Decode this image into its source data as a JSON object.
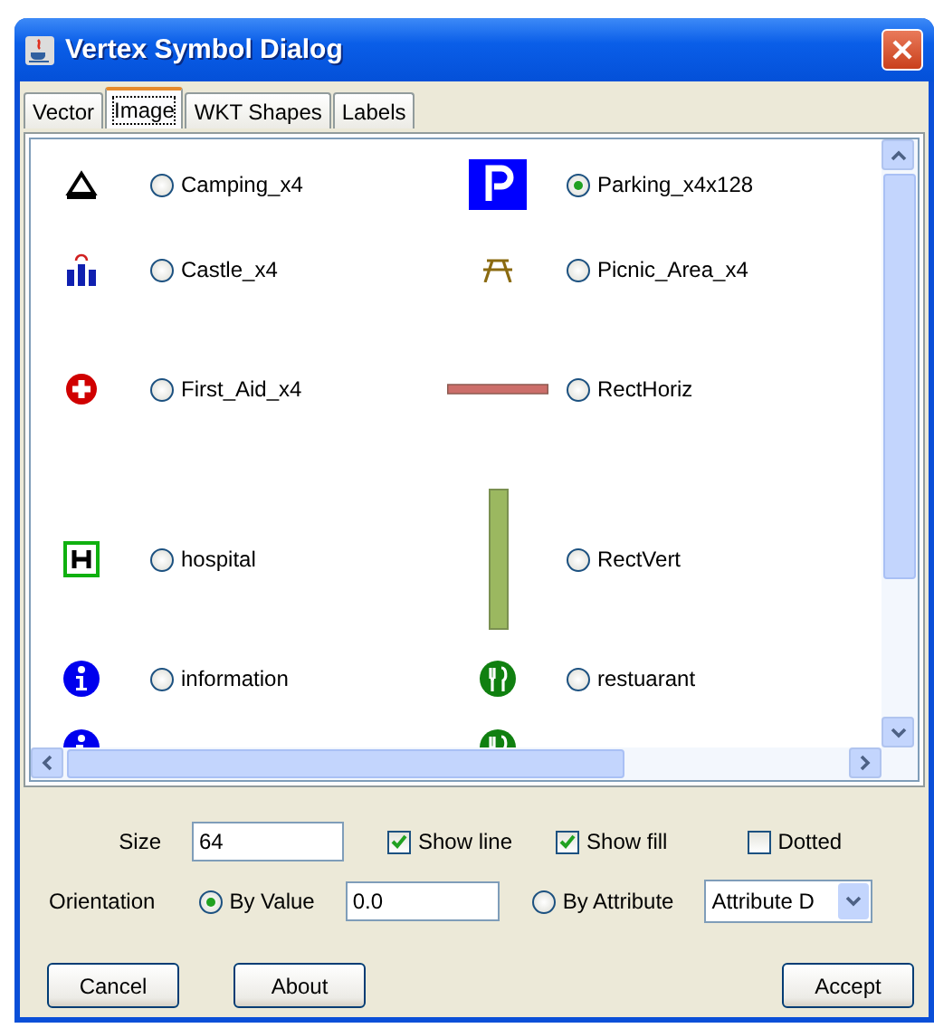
{
  "window": {
    "title": "Vertex Symbol Dialog"
  },
  "tabs": [
    {
      "label": "Vector",
      "selected": false
    },
    {
      "label": "Image",
      "selected": true
    },
    {
      "label": "WKT Shapes",
      "selected": false
    },
    {
      "label": "Labels",
      "selected": false
    }
  ],
  "symbols": [
    {
      "kind": "tent",
      "label": "Camping_x4",
      "selected": false
    },
    {
      "kind": "parking",
      "label": "Parking_x4x128",
      "selected": true
    },
    {
      "kind": "castle",
      "label": "Castle_x4",
      "selected": false
    },
    {
      "kind": "picnic",
      "label": "Picnic_Area_x4",
      "selected": false
    },
    {
      "kind": "firstaid",
      "label": "First_Aid_x4",
      "selected": false
    },
    {
      "kind": "recthoriz",
      "label": "RectHoriz",
      "selected": false
    },
    {
      "kind": "hospital",
      "label": "hospital",
      "selected": false
    },
    {
      "kind": "rectvert",
      "label": "RectVert",
      "selected": false
    },
    {
      "kind": "info",
      "label": "information",
      "selected": false
    },
    {
      "kind": "restaurant",
      "label": "restuarant",
      "selected": false
    },
    {
      "kind": "info"
    },
    {
      "kind": "restaurant"
    }
  ],
  "size": {
    "label": "Size",
    "value": "64"
  },
  "options": [
    {
      "label": "Show line",
      "checked": true
    },
    {
      "label": "Show fill",
      "checked": true
    },
    {
      "label": "Dotted",
      "checked": false
    }
  ],
  "orientation": {
    "label": "Orientation",
    "by_value": {
      "label": "By Value",
      "selected": true
    },
    "value": "0.0",
    "by_attribute": {
      "label": "By Attribute",
      "selected": false
    },
    "attribute": "Attribute D"
  },
  "buttons": [
    {
      "label": "Cancel"
    },
    {
      "label": "About"
    },
    {
      "label": "Accept"
    }
  ]
}
